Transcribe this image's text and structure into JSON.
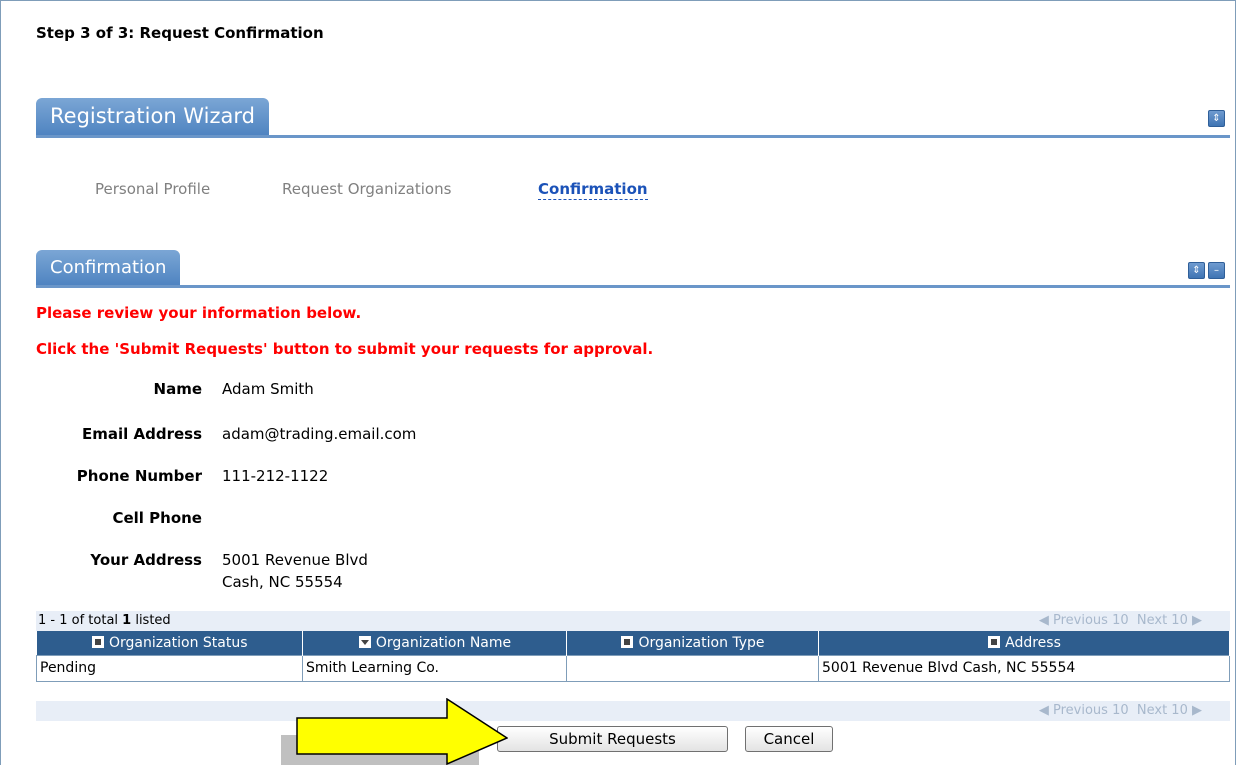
{
  "page": {
    "step_title": "Step 3 of 3: Request Confirmation"
  },
  "wizard": {
    "tab_label": "Registration Wizard",
    "steps": [
      {
        "label": "Personal Profile",
        "active": false
      },
      {
        "label": "Request Organizations",
        "active": false
      },
      {
        "label": "Confirmation",
        "active": true
      }
    ]
  },
  "confirmation": {
    "tab_label": "Confirmation",
    "messages": [
      "Please review your information below.",
      "Click the 'Submit Requests' button to submit your requests for approval."
    ],
    "fields": [
      {
        "label": "Name",
        "value": "Adam Smith"
      },
      {
        "label": "Email Address",
        "value": "adam@trading.email.com"
      },
      {
        "label": "Phone Number",
        "value": "111-212-1122"
      },
      {
        "label": "Cell Phone",
        "value": ""
      },
      {
        "label": "Your Address",
        "value": "5001 Revenue Blvd",
        "value2": "Cash, NC 55554"
      }
    ]
  },
  "grid": {
    "count_prefix": "1 - 1 of total ",
    "count_total": "1",
    "count_suffix": " listed",
    "prev_label": "Previous 10",
    "next_label": "Next 10",
    "columns": [
      {
        "label": "Organization Status",
        "sort": "none"
      },
      {
        "label": "Organization Name",
        "sort": "desc"
      },
      {
        "label": "Organization Type",
        "sort": "none"
      },
      {
        "label": "Address",
        "sort": "none"
      }
    ],
    "rows": [
      [
        "Pending",
        "Smith Learning Co.",
        "",
        "5001 Revenue Blvd Cash, NC 55554"
      ]
    ]
  },
  "actions": {
    "submit_label": "Submit Requests",
    "cancel_label": "Cancel"
  },
  "colors": {
    "accent": "#4f84c1",
    "header": "#2e5d8e",
    "warning": "#ff0000",
    "arrow": "#ffff00"
  }
}
